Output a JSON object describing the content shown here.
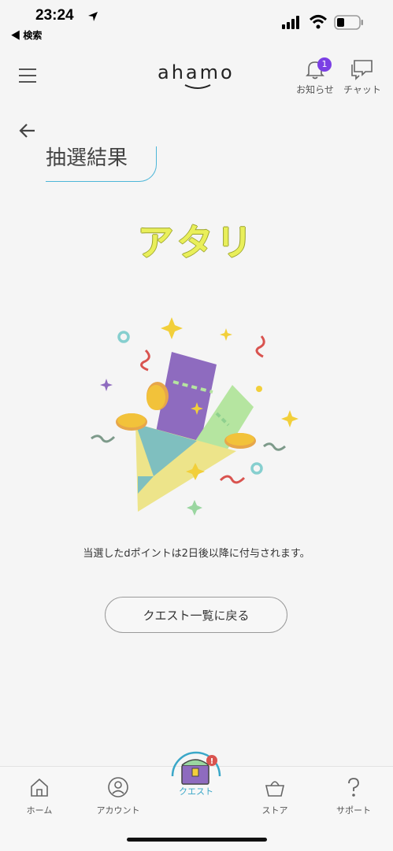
{
  "status_bar": {
    "time": "23:24",
    "back_label": "◀ 検索"
  },
  "header": {
    "logo": "ahamo",
    "notifications_label": "お知らせ",
    "notifications_badge": "1",
    "chat_label": "チャット"
  },
  "page": {
    "title": "抽選結果",
    "result": "アタリ",
    "notice": "当選したdポイントは2日後以降に付与されます。",
    "back_to_quests": "クエスト一覧に戻る"
  },
  "bottom_nav": {
    "items": [
      {
        "label": "ホーム",
        "icon": "home-icon"
      },
      {
        "label": "アカウント",
        "icon": "account-icon"
      },
      {
        "label": "クエスト",
        "icon": "treasure-chest-icon",
        "active": true
      },
      {
        "label": "ストア",
        "icon": "basket-icon"
      },
      {
        "label": "サポート",
        "icon": "question-icon"
      }
    ]
  },
  "colors": {
    "accent": "#3aa7c8",
    "badge": "#7b3fe4",
    "result_text": "#e9ef5a"
  }
}
